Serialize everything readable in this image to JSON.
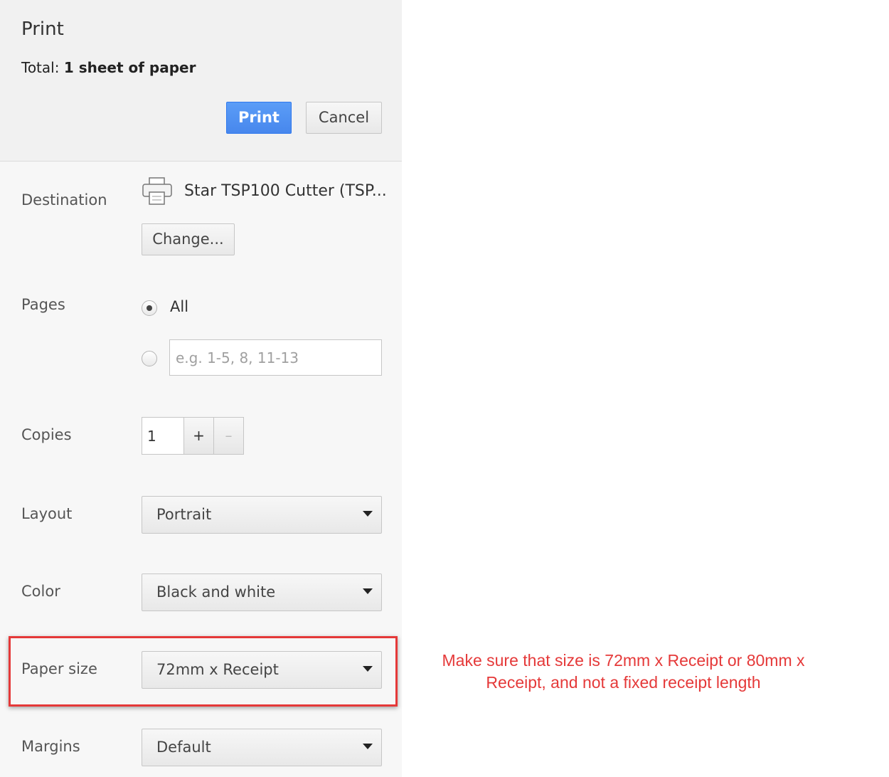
{
  "dialog": {
    "title": "Print",
    "total_label": "Total:",
    "total_value": "1 sheet of paper",
    "print_button": "Print",
    "cancel_button": "Cancel"
  },
  "destination": {
    "label": "Destination",
    "icon": "printer-icon",
    "printer_name": "Star TSP100 Cutter (TSP...",
    "change_button": "Change..."
  },
  "pages": {
    "label": "Pages",
    "option_all": "All",
    "selected": "All",
    "range_placeholder": "e.g. 1-5, 8, 11-13"
  },
  "copies": {
    "label": "Copies",
    "value": "1",
    "plus": "+",
    "minus": "–"
  },
  "layout": {
    "label": "Layout",
    "value": "Portrait"
  },
  "color": {
    "label": "Color",
    "value": "Black and white"
  },
  "paper_size": {
    "label": "Paper size",
    "value": "72mm x Receipt"
  },
  "margins": {
    "label": "Margins",
    "value": "Default"
  },
  "annotation": {
    "text": "Make sure that size is 72mm x Receipt or 80mm x Receipt, and not a fixed receipt length",
    "color": "#e53939"
  },
  "colors": {
    "primary_button": "#4787ed",
    "highlight_border": "#e53939"
  }
}
